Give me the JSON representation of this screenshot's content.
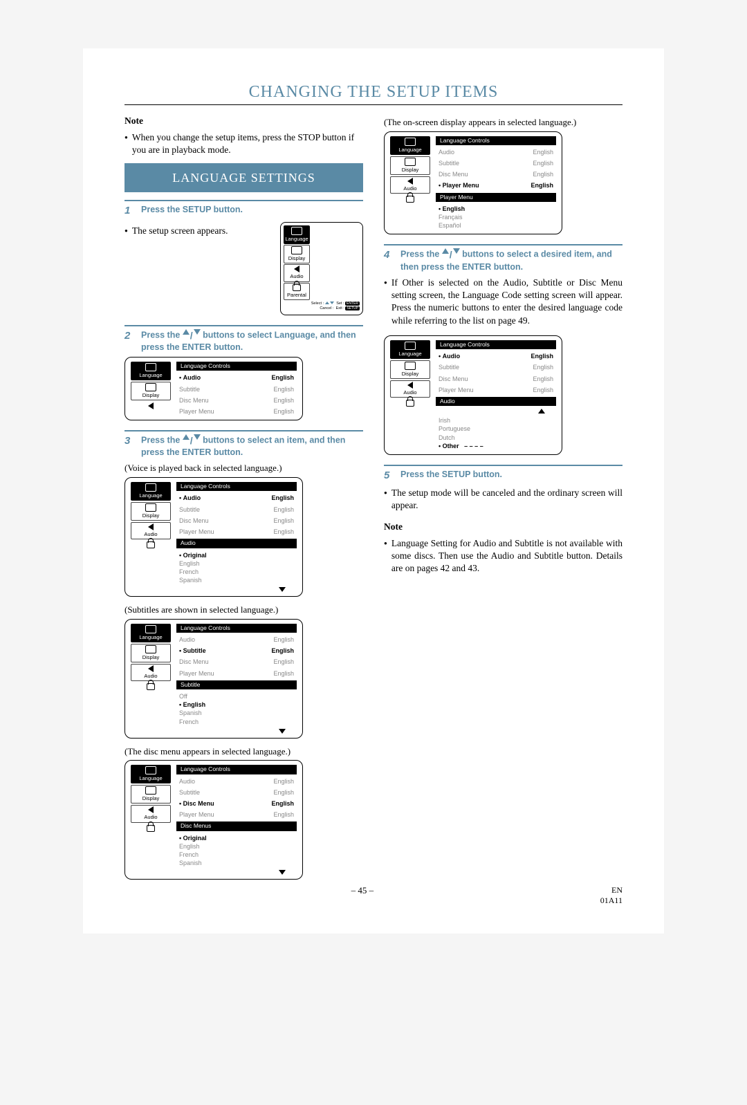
{
  "title": "CHANGING THE SETUP ITEMS",
  "note_label": "Note",
  "intro_bullet": "When you change the setup items, press the STOP button if you are in playback mode.",
  "banner": "LANGUAGE SETTINGS",
  "steps": {
    "s1": "Press the SETUP button.",
    "s1b": "The setup screen appears.",
    "s2a": "Press the ",
    "s2b": " buttons to select Language, and then press the ENTER button.",
    "s3a": "Press the ",
    "s3b": " buttons to select an item, and then press the ENTER button.",
    "s4a": "Press the ",
    "s4b": " buttons to select a desired item, and then press the ENTER button.",
    "s5": "Press the SETUP button."
  },
  "cap_voice": "(Voice is played back in selected language.)",
  "cap_sub": "(Subtitles are shown in selected language.)",
  "cap_disc": "(The disc menu appears in selected language.)",
  "cap_player": "(The on-screen display appears in selected language.)",
  "right_p1": "If Other is selected on the Audio, Subtitle or Disc Menu setting screen, the Language Code setting screen will appear. Press the numeric buttons to enter the desired language code while referring to the list on page 49.",
  "right_p2": "The setup mode will be canceled and the ordinary screen will appear.",
  "right_note": "Language Setting for Audio and Subtitle is not available with some discs. Then use the Audio and Subtitle button. Details are on pages 42 and 43.",
  "tabs": {
    "language": "Language",
    "display": "Display",
    "audio": "Audio",
    "parental": "Parental"
  },
  "panel_title": "Language Controls",
  "rows": {
    "audio": "Audio",
    "subtitle": "Subtitle",
    "discmenu": "Disc Menu",
    "playermenu": "Player Menu",
    "english": "English"
  },
  "audio_opts": {
    "title": "Audio",
    "original": "Original",
    "english": "English",
    "french": "French",
    "spanish": "Spanish"
  },
  "subtitle_opts": {
    "title": "Subtitle",
    "off": "Off",
    "english": "English",
    "spanish": "Spanish",
    "french": "French"
  },
  "discmenu_opts": {
    "title": "Disc Menus",
    "original": "Original",
    "english": "English",
    "french": "French",
    "spanish": "Spanish"
  },
  "player_opts": {
    "title": "Player Menu",
    "english": "English",
    "francais": "Français",
    "espanol": "Español"
  },
  "audio2_opts": {
    "title": "Audio",
    "irish": "Irish",
    "portuguese": "Portuguese",
    "dutch": "Dutch",
    "other": "Other"
  },
  "mini": {
    "select": "Select :",
    "set": "Set :",
    "cancel": "Cancel :",
    "exit": "Exit :",
    "enter": "ENTER",
    "setup": "SETUP"
  },
  "footer": {
    "page": "– 45 –",
    "en": "EN",
    "code": "01A11"
  }
}
